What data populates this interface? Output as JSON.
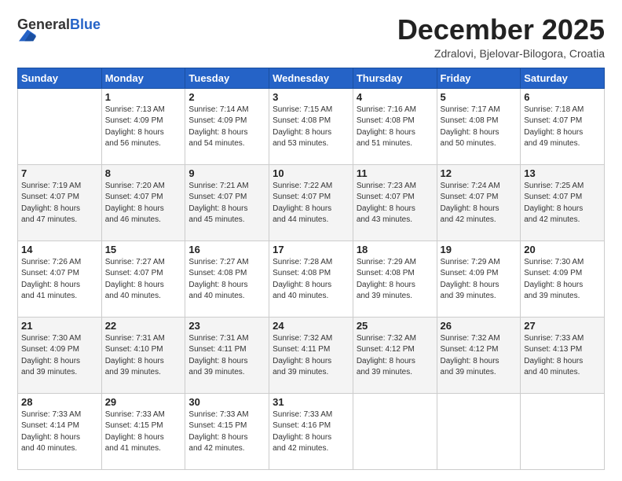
{
  "header": {
    "logo_general": "General",
    "logo_blue": "Blue",
    "month_title": "December 2025",
    "location": "Zdralovi, Bjelovar-Bilogora, Croatia"
  },
  "days_of_week": [
    "Sunday",
    "Monday",
    "Tuesday",
    "Wednesday",
    "Thursday",
    "Friday",
    "Saturday"
  ],
  "weeks": [
    [
      {
        "day": "",
        "info": ""
      },
      {
        "day": "1",
        "info": "Sunrise: 7:13 AM\nSunset: 4:09 PM\nDaylight: 8 hours\nand 56 minutes."
      },
      {
        "day": "2",
        "info": "Sunrise: 7:14 AM\nSunset: 4:09 PM\nDaylight: 8 hours\nand 54 minutes."
      },
      {
        "day": "3",
        "info": "Sunrise: 7:15 AM\nSunset: 4:08 PM\nDaylight: 8 hours\nand 53 minutes."
      },
      {
        "day": "4",
        "info": "Sunrise: 7:16 AM\nSunset: 4:08 PM\nDaylight: 8 hours\nand 51 minutes."
      },
      {
        "day": "5",
        "info": "Sunrise: 7:17 AM\nSunset: 4:08 PM\nDaylight: 8 hours\nand 50 minutes."
      },
      {
        "day": "6",
        "info": "Sunrise: 7:18 AM\nSunset: 4:07 PM\nDaylight: 8 hours\nand 49 minutes."
      }
    ],
    [
      {
        "day": "7",
        "info": "Sunrise: 7:19 AM\nSunset: 4:07 PM\nDaylight: 8 hours\nand 47 minutes."
      },
      {
        "day": "8",
        "info": "Sunrise: 7:20 AM\nSunset: 4:07 PM\nDaylight: 8 hours\nand 46 minutes."
      },
      {
        "day": "9",
        "info": "Sunrise: 7:21 AM\nSunset: 4:07 PM\nDaylight: 8 hours\nand 45 minutes."
      },
      {
        "day": "10",
        "info": "Sunrise: 7:22 AM\nSunset: 4:07 PM\nDaylight: 8 hours\nand 44 minutes."
      },
      {
        "day": "11",
        "info": "Sunrise: 7:23 AM\nSunset: 4:07 PM\nDaylight: 8 hours\nand 43 minutes."
      },
      {
        "day": "12",
        "info": "Sunrise: 7:24 AM\nSunset: 4:07 PM\nDaylight: 8 hours\nand 42 minutes."
      },
      {
        "day": "13",
        "info": "Sunrise: 7:25 AM\nSunset: 4:07 PM\nDaylight: 8 hours\nand 42 minutes."
      }
    ],
    [
      {
        "day": "14",
        "info": "Sunrise: 7:26 AM\nSunset: 4:07 PM\nDaylight: 8 hours\nand 41 minutes."
      },
      {
        "day": "15",
        "info": "Sunrise: 7:27 AM\nSunset: 4:07 PM\nDaylight: 8 hours\nand 40 minutes."
      },
      {
        "day": "16",
        "info": "Sunrise: 7:27 AM\nSunset: 4:08 PM\nDaylight: 8 hours\nand 40 minutes."
      },
      {
        "day": "17",
        "info": "Sunrise: 7:28 AM\nSunset: 4:08 PM\nDaylight: 8 hours\nand 40 minutes."
      },
      {
        "day": "18",
        "info": "Sunrise: 7:29 AM\nSunset: 4:08 PM\nDaylight: 8 hours\nand 39 minutes."
      },
      {
        "day": "19",
        "info": "Sunrise: 7:29 AM\nSunset: 4:09 PM\nDaylight: 8 hours\nand 39 minutes."
      },
      {
        "day": "20",
        "info": "Sunrise: 7:30 AM\nSunset: 4:09 PM\nDaylight: 8 hours\nand 39 minutes."
      }
    ],
    [
      {
        "day": "21",
        "info": "Sunrise: 7:30 AM\nSunset: 4:09 PM\nDaylight: 8 hours\nand 39 minutes."
      },
      {
        "day": "22",
        "info": "Sunrise: 7:31 AM\nSunset: 4:10 PM\nDaylight: 8 hours\nand 39 minutes."
      },
      {
        "day": "23",
        "info": "Sunrise: 7:31 AM\nSunset: 4:11 PM\nDaylight: 8 hours\nand 39 minutes."
      },
      {
        "day": "24",
        "info": "Sunrise: 7:32 AM\nSunset: 4:11 PM\nDaylight: 8 hours\nand 39 minutes."
      },
      {
        "day": "25",
        "info": "Sunrise: 7:32 AM\nSunset: 4:12 PM\nDaylight: 8 hours\nand 39 minutes."
      },
      {
        "day": "26",
        "info": "Sunrise: 7:32 AM\nSunset: 4:12 PM\nDaylight: 8 hours\nand 39 minutes."
      },
      {
        "day": "27",
        "info": "Sunrise: 7:33 AM\nSunset: 4:13 PM\nDaylight: 8 hours\nand 40 minutes."
      }
    ],
    [
      {
        "day": "28",
        "info": "Sunrise: 7:33 AM\nSunset: 4:14 PM\nDaylight: 8 hours\nand 40 minutes."
      },
      {
        "day": "29",
        "info": "Sunrise: 7:33 AM\nSunset: 4:15 PM\nDaylight: 8 hours\nand 41 minutes."
      },
      {
        "day": "30",
        "info": "Sunrise: 7:33 AM\nSunset: 4:15 PM\nDaylight: 8 hours\nand 42 minutes."
      },
      {
        "day": "31",
        "info": "Sunrise: 7:33 AM\nSunset: 4:16 PM\nDaylight: 8 hours\nand 42 minutes."
      },
      {
        "day": "",
        "info": ""
      },
      {
        "day": "",
        "info": ""
      },
      {
        "day": "",
        "info": ""
      }
    ]
  ]
}
